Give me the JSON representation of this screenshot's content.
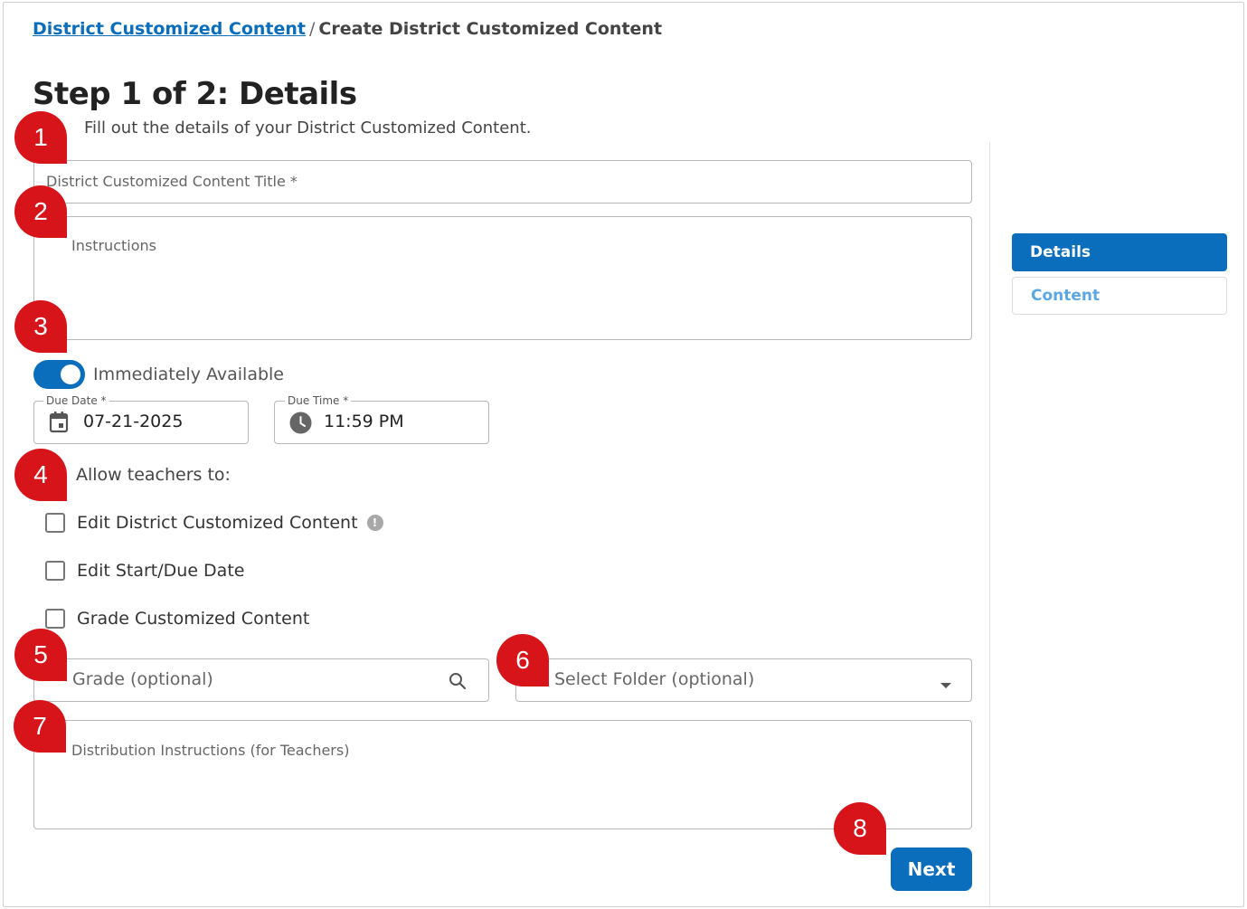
{
  "breadcrumb": {
    "parent": "District Customized Content",
    "separator": "/",
    "current": "Create District Customized Content"
  },
  "page": {
    "title": "Step 1 of 2: Details",
    "subtitle": "Fill out the details of your District Customized Content."
  },
  "form": {
    "title_placeholder": "District Customized Content Title *",
    "instructions_placeholder": "Instructions",
    "immediately_available_label": "Immediately Available",
    "immediately_available_on": true,
    "due_date_label": "Due Date *",
    "due_date_value": "07-21-2025",
    "due_time_label": "Due Time *",
    "due_time_value": "11:59 PM",
    "allow_label": "Allow teachers to:",
    "checkboxes": [
      {
        "label": "Edit District Customized Content",
        "checked": false,
        "info": "!"
      },
      {
        "label": "Edit Start/Due Date",
        "checked": false
      },
      {
        "label": "Grade Customized Content",
        "checked": false
      }
    ],
    "grade_placeholder": "Grade (optional)",
    "folder_placeholder": "Select Folder (optional)",
    "distribution_placeholder": "Distribution Instructions (for Teachers)",
    "next_label": "Next"
  },
  "side_tabs": [
    {
      "label": "Details",
      "active": true
    },
    {
      "label": "Content",
      "active": false
    }
  ],
  "markers": [
    "1",
    "2",
    "3",
    "4",
    "5",
    "6",
    "7",
    "8"
  ],
  "colors": {
    "accent": "#0a6ebd",
    "marker": "#d7141a",
    "tab_inactive_text": "#5aa7e3"
  },
  "icons": {
    "calendar": "calendar-icon",
    "clock": "clock-icon",
    "search": "search-icon",
    "dropdown": "chevron-down-icon"
  }
}
